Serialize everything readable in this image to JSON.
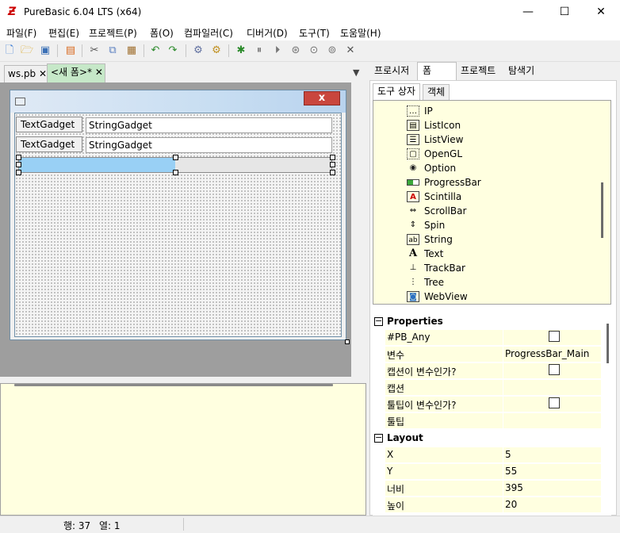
{
  "window": {
    "title": "PureBasic 6.04 LTS (x64)",
    "minimize": "—",
    "maximize": "☐",
    "close": "✕"
  },
  "menu": [
    "파일(F)",
    "편집(E)",
    "프로젝트(P)",
    "폼(O)",
    "컴파일러(C)",
    "디버거(D)",
    "도구(T)",
    "도움말(H)"
  ],
  "file_tabs": [
    {
      "label": "ws.pb",
      "close": "✕"
    },
    {
      "label": "<새 폼>*",
      "close": "✕"
    }
  ],
  "form": {
    "close_glyph": "x",
    "text_gadgets": [
      "TextGadget",
      "TextGadget"
    ],
    "string_gadgets": [
      "StringGadget",
      "StringGadget"
    ],
    "progress": 0.5
  },
  "right_tabs": [
    "프로시저",
    "폼",
    "프로젝트",
    "탐색기"
  ],
  "sub_tabs": [
    "도구 상자",
    "객체"
  ],
  "toolbox": [
    {
      "label": "IP",
      "icon": "ip-icon",
      "glyph": "…"
    },
    {
      "label": "ListIcon",
      "icon": "listicon-icon",
      "glyph": "▤"
    },
    {
      "label": "ListView",
      "icon": "listview-icon",
      "glyph": "☰"
    },
    {
      "label": "OpenGL",
      "icon": "opengl-icon",
      "glyph": "▢"
    },
    {
      "label": "Option",
      "icon": "option-icon",
      "glyph": "◉"
    },
    {
      "label": "ProgressBar",
      "icon": "progressbar-icon",
      "glyph": "▭"
    },
    {
      "label": "Scintilla",
      "icon": "scintilla-icon",
      "glyph": "A"
    },
    {
      "label": "ScrollBar",
      "icon": "scrollbar-icon",
      "glyph": "⇔"
    },
    {
      "label": "Spin",
      "icon": "spin-icon",
      "glyph": "⇕"
    },
    {
      "label": "String",
      "icon": "string-icon",
      "glyph": "ab"
    },
    {
      "label": "Text",
      "icon": "text-icon",
      "glyph": "A"
    },
    {
      "label": "TrackBar",
      "icon": "trackbar-icon",
      "glyph": "⊥"
    },
    {
      "label": "Tree",
      "icon": "tree-icon",
      "glyph": "⋮"
    },
    {
      "label": "WebView",
      "icon": "webview-icon",
      "glyph": "◙"
    }
  ],
  "properties": {
    "title": "Properties",
    "rows": [
      {
        "name": "#PB_Any",
        "value": "",
        "checkbox": true
      },
      {
        "name": "변수",
        "value": "ProgressBar_Main",
        "checkbox": false
      },
      {
        "name": "캡션이 변수인가?",
        "value": "",
        "checkbox": true
      },
      {
        "name": "캡션",
        "value": "",
        "checkbox": false
      },
      {
        "name": "툴팁이 변수인가?",
        "value": "",
        "checkbox": true
      },
      {
        "name": "툴팁",
        "value": "",
        "checkbox": false
      }
    ]
  },
  "layout": {
    "title": "Layout",
    "rows": [
      {
        "name": "X",
        "value": "5"
      },
      {
        "name": "Y",
        "value": "55"
      },
      {
        "name": "너비",
        "value": "395"
      },
      {
        "name": "높이",
        "value": "20"
      }
    ]
  },
  "status": {
    "line": "행: 37",
    "col": "열: 1"
  },
  "colors": {
    "accent": "#99d0f5",
    "panel_bg": "#ffffe0"
  }
}
